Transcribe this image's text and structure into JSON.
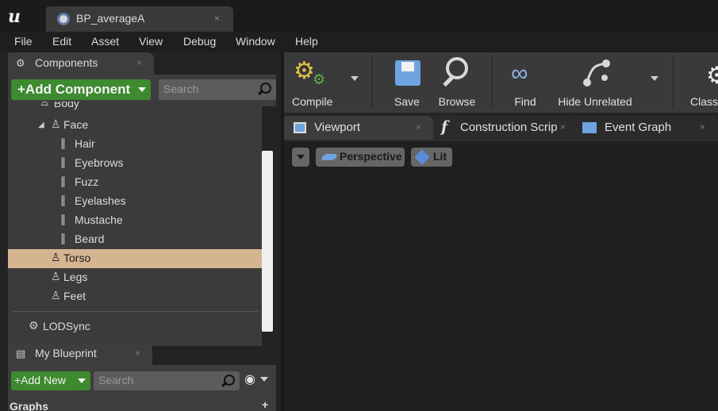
{
  "window": {
    "logo_text": "u",
    "tab_title": "BP_averageA",
    "tab_close": "×"
  },
  "menu": [
    "File",
    "Edit",
    "Asset",
    "View",
    "Debug",
    "Window",
    "Help"
  ],
  "components_panel": {
    "tab_label": "Components",
    "close": "×",
    "add_button": "+Add Component",
    "search_placeholder": "Search",
    "tree": [
      {
        "label": "Body",
        "icon": "person-icon"
      },
      {
        "label": "Face",
        "icon": "person-icon",
        "expanded": true
      },
      {
        "label": "Hair",
        "icon": "hair-icon"
      },
      {
        "label": "Eyebrows",
        "icon": "hair-icon"
      },
      {
        "label": "Fuzz",
        "icon": "hair-icon"
      },
      {
        "label": "Eyelashes",
        "icon": "hair-icon"
      },
      {
        "label": "Mustache",
        "icon": "hair-icon"
      },
      {
        "label": "Beard",
        "icon": "hair-icon"
      },
      {
        "label": "Torso",
        "icon": "person-icon",
        "selected": true
      },
      {
        "label": "Legs",
        "icon": "person-icon"
      },
      {
        "label": "Feet",
        "icon": "person-icon"
      }
    ],
    "lodsync_label": "LODSync"
  },
  "blueprint_panel": {
    "tab_label": "My Blueprint",
    "close": "×",
    "add_button": "+Add New",
    "search_placeholder": "Search",
    "graphs_label": "Graphs"
  },
  "toolbar": {
    "compile": "Compile",
    "save": "Save",
    "browse": "Browse",
    "find": "Find",
    "hide_unrelated": "Hide Unrelated",
    "class_settings": "Class"
  },
  "editor_tabs": [
    {
      "label": "Viewport",
      "close": "×"
    },
    {
      "label": "Construction Scrip",
      "close": "×"
    },
    {
      "label": "Event Graph",
      "close": "×"
    }
  ],
  "viewport": {
    "perspective": "Perspective",
    "lit": "Lit"
  },
  "colors": {
    "accent_green": "#3d8a2f",
    "selection": "#d5b591",
    "panel_bg": "#3b3b3b",
    "toolbar_bg": "#3a3a3a",
    "viewport_bg": "#1f1f1f"
  }
}
